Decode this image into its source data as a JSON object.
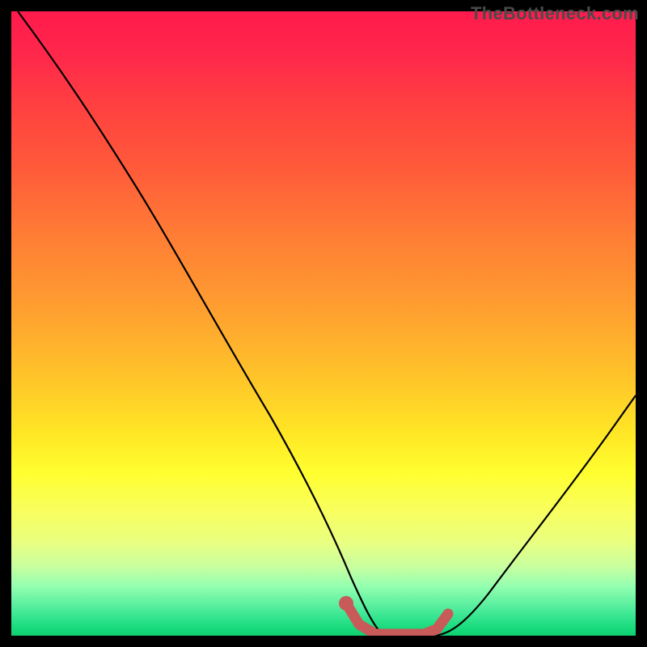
{
  "watermark": "TheBottleneck.com",
  "colors": {
    "curve": "#000000",
    "highlight": "#c85a5a",
    "frame": "#000000"
  },
  "chart_data": {
    "type": "line",
    "title": "",
    "xlabel": "",
    "ylabel": "",
    "xlim": [
      0,
      100
    ],
    "ylim": [
      0,
      100
    ],
    "series": [
      {
        "name": "bottleneck-curve",
        "x": [
          0,
          5,
          10,
          15,
          20,
          25,
          30,
          35,
          40,
          45,
          50,
          52,
          55,
          58,
          60,
          63,
          66,
          70,
          75,
          80,
          85,
          90,
          95,
          100
        ],
        "values": [
          100,
          92,
          84,
          76,
          67,
          58,
          49,
          40,
          31,
          22,
          13,
          9,
          4,
          1,
          0,
          0,
          0,
          2,
          7,
          13,
          20,
          27,
          35,
          43
        ]
      },
      {
        "name": "optimal-zone-highlight",
        "x": [
          52,
          55,
          58,
          60,
          63,
          66
        ],
        "values": [
          4,
          1,
          0,
          0,
          0,
          2
        ]
      }
    ],
    "annotations": [
      {
        "type": "marker-dot",
        "x": 52,
        "y": 4
      }
    ]
  }
}
